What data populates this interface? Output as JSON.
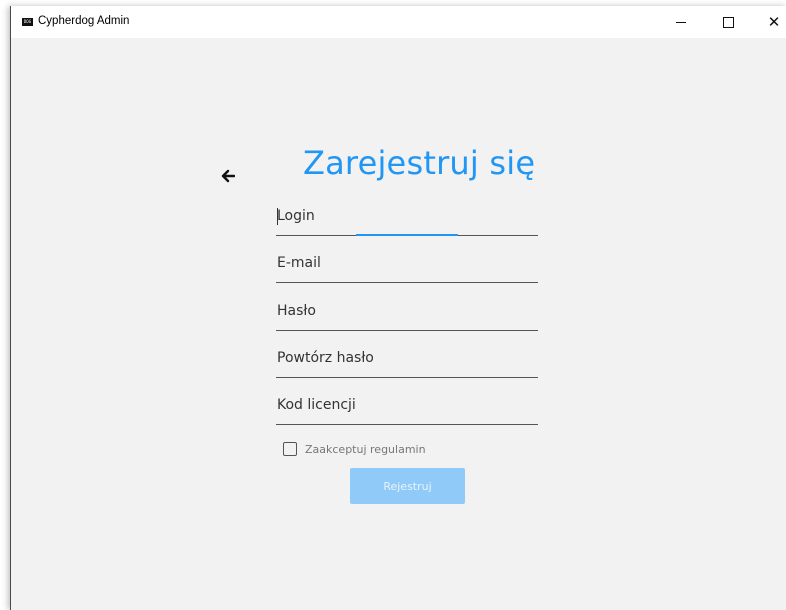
{
  "window": {
    "title": "Cypherdog Admin",
    "logo_text": "DOG",
    "controls": {
      "minimize": "minimize",
      "maximize": "maximize",
      "close": "✕"
    }
  },
  "form": {
    "title": "Zarejestruj się",
    "back_icon": "arrow-left-icon",
    "fields": [
      {
        "label": "Login",
        "focused": true
      },
      {
        "label": "E-mail"
      },
      {
        "label": "Hasło"
      },
      {
        "label": "Powtórz hasło"
      },
      {
        "label": "Kod licencji"
      }
    ],
    "terms_label": "Zaakceptuj regulamin",
    "terms_checked": false,
    "submit_label": "Rejestruj",
    "submit_disabled": true
  },
  "colors": {
    "accent": "#2196f3",
    "button_disabled": "#90caf9",
    "background": "#f2f2f2"
  }
}
